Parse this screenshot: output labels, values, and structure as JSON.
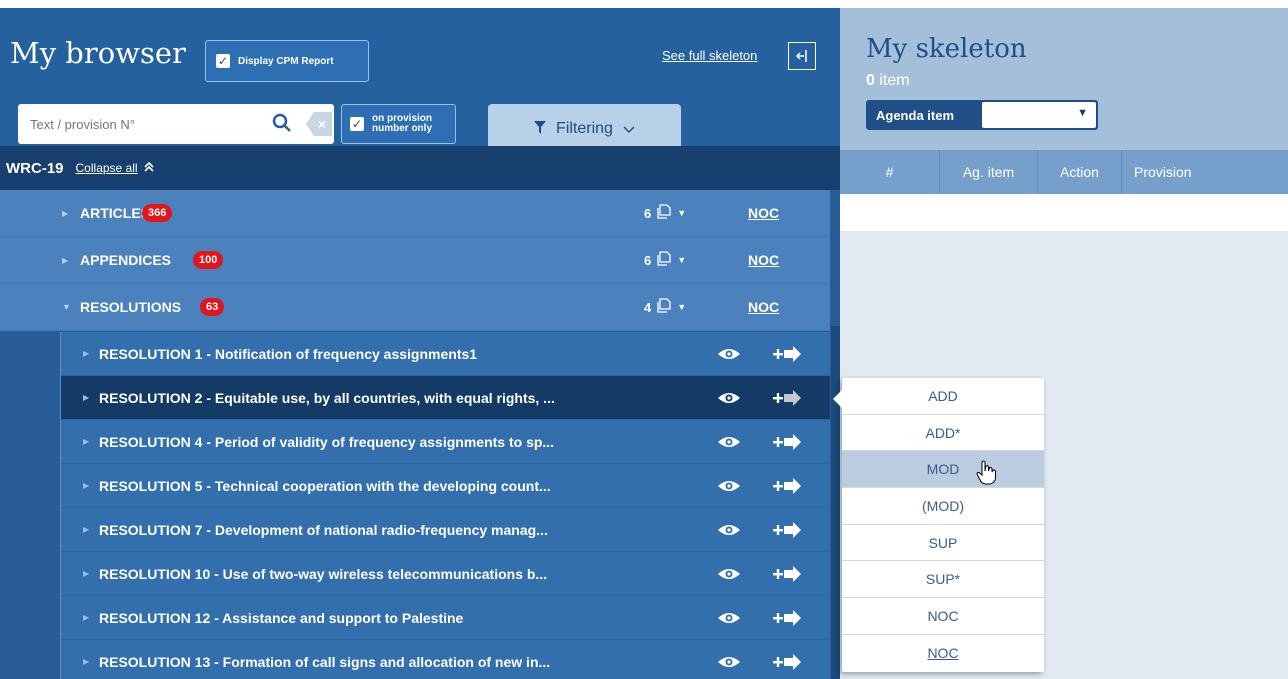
{
  "browser": {
    "title": "My browser",
    "cpm_report_label": "Display CPM Report",
    "see_full_skeleton": "See full skeleton",
    "search_placeholder": "Text / provision N°",
    "on_provision_line1": "on provision",
    "on_provision_line2": "number only",
    "filtering_label": "Filtering",
    "wrc_title": "WRC-19",
    "collapse_all": "Collapse all",
    "categories": [
      {
        "label": "ARTICLES",
        "count": "366",
        "docs": "6",
        "noc": "NOC"
      },
      {
        "label": "APPENDICES",
        "count": "100",
        "docs": "6",
        "noc": "NOC"
      },
      {
        "label": "RESOLUTIONS",
        "count": "63",
        "docs": "4",
        "noc": "NOC"
      }
    ],
    "resolutions": [
      {
        "label": "RESOLUTION 1 - Notification of frequency assignments1"
      },
      {
        "label": "RESOLUTION 2 - Equitable use, by all countries, with equal rights, ..."
      },
      {
        "label": "RESOLUTION 4 - Period of validity of frequency assignments to sp..."
      },
      {
        "label": "RESOLUTION 5 - Technical cooperation with the developing count..."
      },
      {
        "label": "RESOLUTION 7 - Development of national radio-frequency manag..."
      },
      {
        "label": "RESOLUTION 10 - Use of two-way wireless telecommunications b..."
      },
      {
        "label": "RESOLUTION 12 - Assistance and support to Palestine"
      },
      {
        "label": "RESOLUTION 13 - Formation of call signs and allocation of new in..."
      }
    ]
  },
  "skeleton": {
    "title": "My skeleton",
    "count": "0",
    "count_unit": "item",
    "agenda_label": "Agenda item",
    "agenda_value": "",
    "columns": [
      "#",
      "Ag. item",
      "Action",
      "Provision"
    ]
  },
  "action_menu": {
    "items": [
      "ADD",
      "ADD*",
      "MOD",
      "(MOD)",
      "SUP",
      "SUP*",
      "NOC",
      "NOC"
    ]
  },
  "colors": {
    "badge": "#e3141b",
    "header_blue": "#25609f",
    "active_row": "#133b66"
  }
}
